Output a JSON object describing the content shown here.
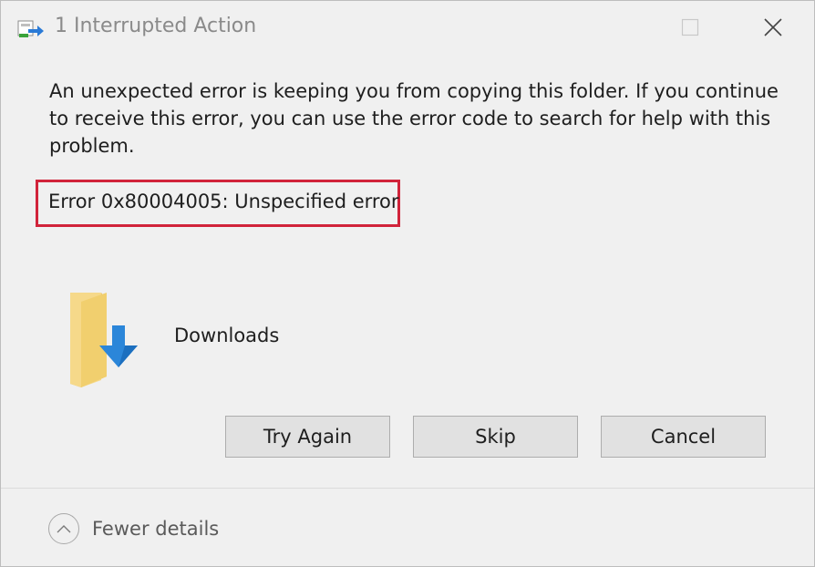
{
  "window": {
    "title": "1 Interrupted Action"
  },
  "titlebar": {
    "icons": [
      "copy-progress-icon",
      "maximize-icon",
      "close-icon"
    ]
  },
  "message": {
    "text": "An unexpected error is keeping you from copying this folder. If you continue to receive this error, you can use the error code to search for help with this problem.",
    "error": "Error 0x80004005: Unspecified error",
    "error_highlight_color": "#d1233a"
  },
  "item": {
    "icon": "downloads-folder-icon",
    "name": "Downloads"
  },
  "buttons": {
    "try_again": "Try Again",
    "skip": "Skip",
    "cancel": "Cancel"
  },
  "footer": {
    "details_toggle": "Fewer details",
    "icon": "chevron-up-icon"
  }
}
